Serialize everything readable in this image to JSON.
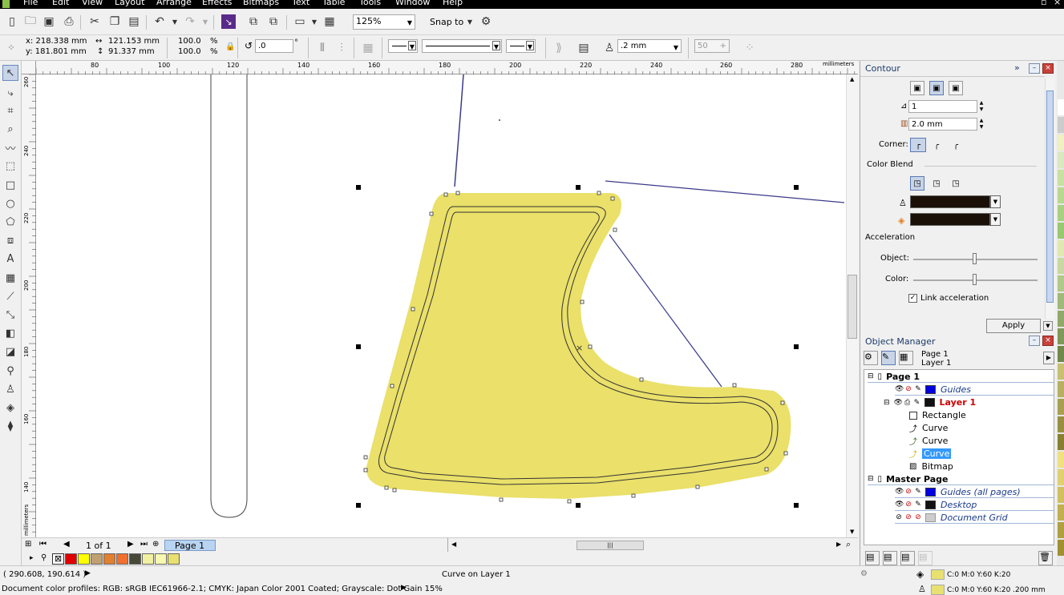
{
  "menu": [
    "File",
    "Edit",
    "View",
    "Layout",
    "Arrange",
    "Effects",
    "Bitmaps",
    "Text",
    "Table",
    "Tools",
    "Window",
    "Help"
  ],
  "toolbar": {
    "zoom": "125%",
    "snap_to": "Snap to"
  },
  "propbar": {
    "x": "x: 218.338 mm",
    "y": "y: 181.801 mm",
    "w": "121.153 mm",
    "h": "91.337 mm",
    "scale_x": "100.0",
    "scale_y": "100.0",
    "pct": "%",
    "rotation": ".0",
    "deg": "°",
    "outline_width": ".2 mm",
    "misc_value": "50"
  },
  "ruler": {
    "h_ticks": [
      "80",
      "100",
      "120",
      "140",
      "160",
      "180",
      "200",
      "220",
      "240",
      "260",
      "280"
    ],
    "h_unit": "millimeters",
    "v_ticks": [
      "260",
      "240",
      "220",
      "200",
      "180",
      "160",
      "140"
    ],
    "v_unit": "millimeters"
  },
  "page_nav": {
    "count": "1 of 1",
    "tab": "Page 1"
  },
  "palette_colors": [
    "#e00000",
    "#ffff00",
    "#c0a070",
    "#e08030",
    "#f07030",
    "#484838",
    "#f0f0a0",
    "#f8f8b0",
    "#e8e070"
  ],
  "status": {
    "coords": "( 290.608, 190.614 )",
    "object": "Curve on Layer 1",
    "profiles": "Document color profiles: RGB: sRGB IEC61966-2.1; CMYK: Japan Color 2001 Coated; Grayscale: Dot Gain 15%",
    "fill_text": "C:0 M:0 Y:60 K:20",
    "outline_text": "C:0 M:0 Y:60 K:20  .200 mm",
    "fill_color": "#e8e070"
  },
  "contour": {
    "title": "Contour",
    "steps": "1",
    "offset": "2.0 mm",
    "corner_label": "Corner:",
    "color_blend_label": "Color Blend",
    "acceleration_label": "Acceleration",
    "object_label": "Object:",
    "color_label": "Color:",
    "link_label": "Link acceleration",
    "apply_label": "Apply",
    "outline_color": "#1a1008",
    "fill_color": "#1a1008"
  },
  "objmgr": {
    "title": "Object Manager",
    "header_page": "Page 1",
    "header_layer": "Layer 1",
    "page1": "Page 1",
    "guides": "Guides",
    "layer1": "Layer 1",
    "items": [
      "Rectangle",
      "Curve",
      "Curve",
      "Curve",
      "Bitmap"
    ],
    "master": "Master Page",
    "master_items": [
      "Guides (all pages)",
      "Desktop",
      "Document Grid"
    ]
  }
}
